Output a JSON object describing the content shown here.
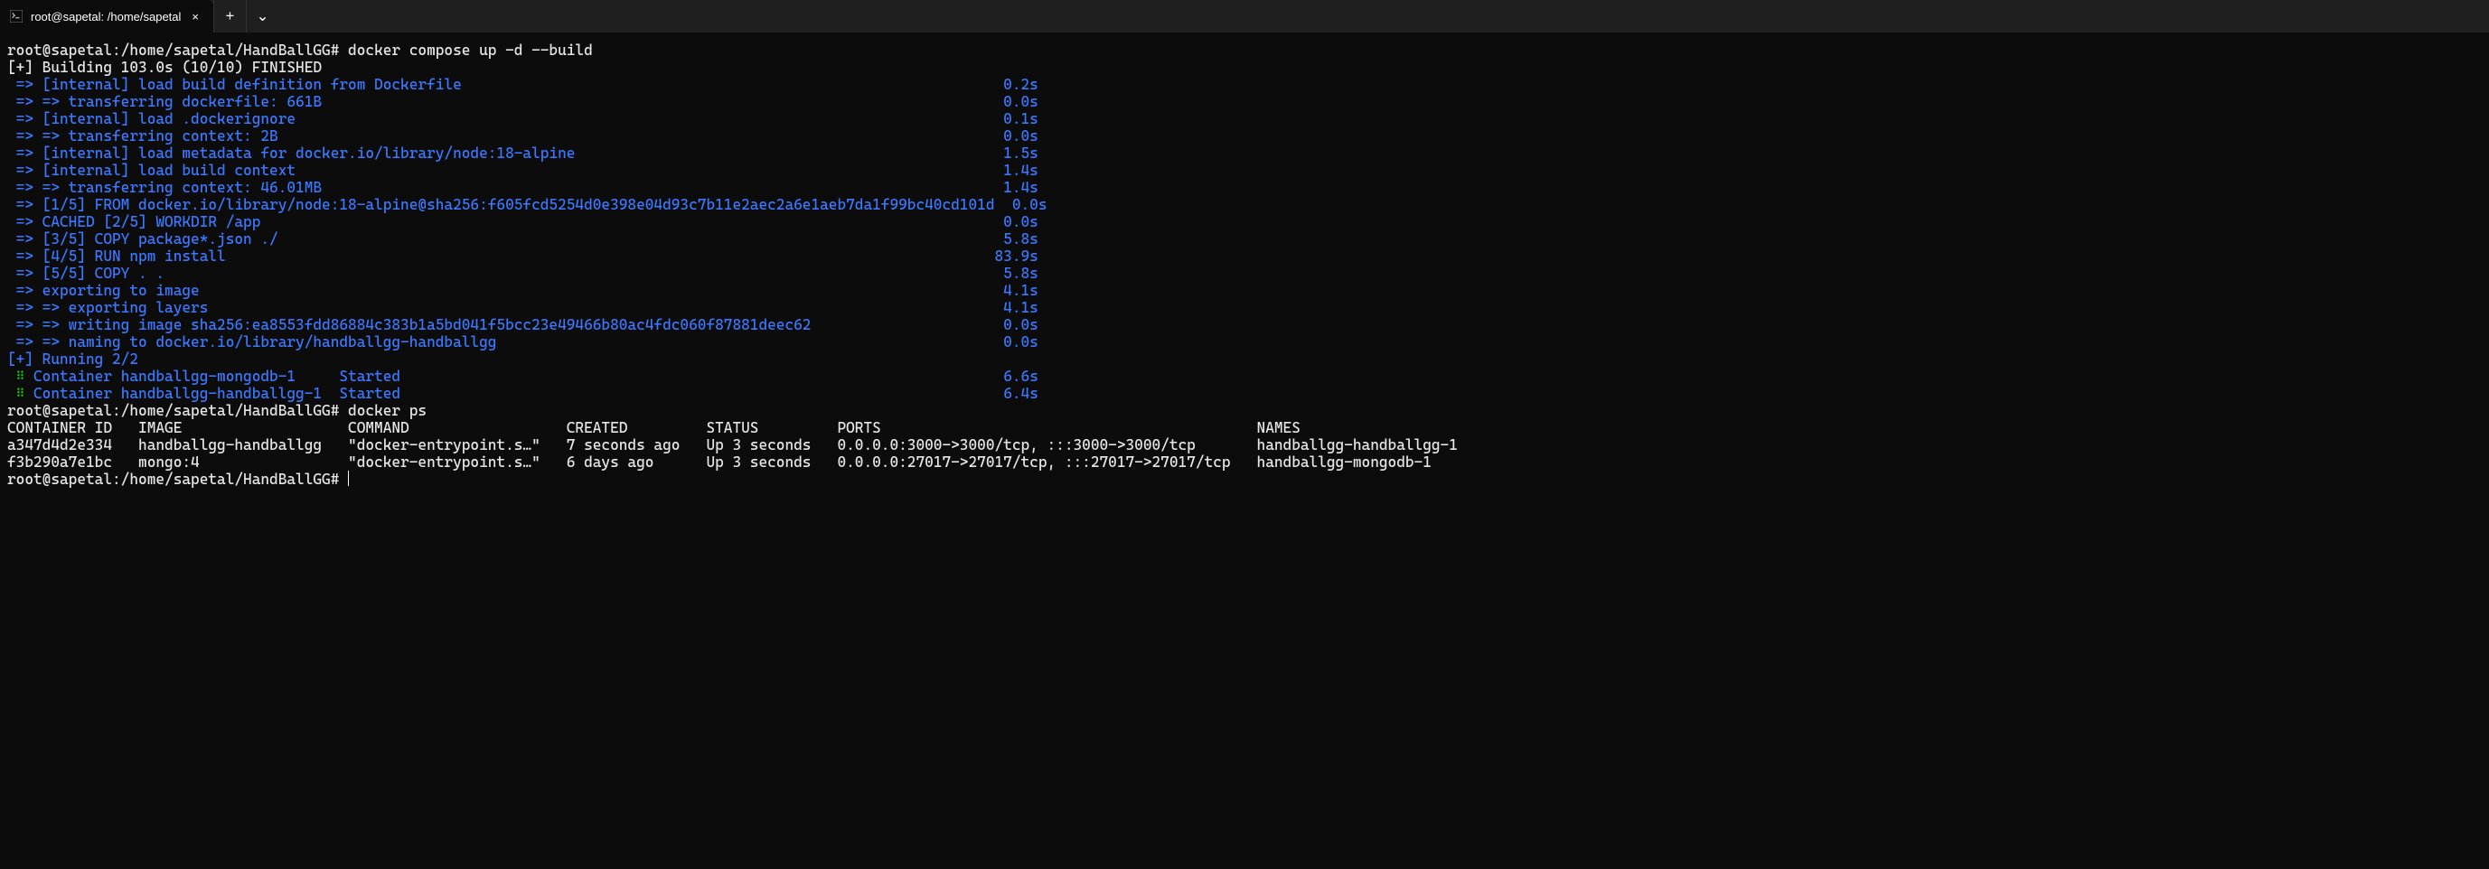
{
  "titlebar": {
    "tab_title": "root@sapetal: /home/sapetal",
    "tab_close": "×",
    "newtab": "+",
    "dropdown": "⌄"
  },
  "prompt1": {
    "user": "root@sapetal",
    "path": ":/home/sapetal/HandBallGG#",
    "cmd": " docker compose up -d --build"
  },
  "build_header": "[+] Building 103.0s (10/10) FINISHED",
  "steps": [
    {
      "txt": " => [internal] load build definition from Dockerfile",
      "time": "0.2s"
    },
    {
      "txt": " => => transferring dockerfile: 661B",
      "time": "0.0s"
    },
    {
      "txt": " => [internal] load .dockerignore",
      "time": "0.1s"
    },
    {
      "txt": " => => transferring context: 2B",
      "time": "0.0s"
    },
    {
      "txt": " => [internal] load metadata for docker.io/library/node:18-alpine",
      "time": "1.5s"
    },
    {
      "txt": " => [internal] load build context",
      "time": "1.4s"
    },
    {
      "txt": " => => transferring context: 46.01MB",
      "time": "1.4s"
    },
    {
      "txt": " => [1/5] FROM docker.io/library/node:18-alpine@sha256:f605fcd5254d0e398e04d93c7b11e2aec2a6e1aeb7da1f99bc40cd101d",
      "time": "0.0s"
    },
    {
      "txt": " => CACHED [2/5] WORKDIR /app",
      "time": "0.0s"
    },
    {
      "txt": " => [3/5] COPY package*.json ./",
      "time": "5.8s"
    },
    {
      "txt": " => [4/5] RUN npm install",
      "time": "83.9s"
    },
    {
      "txt": " => [5/5] COPY . .",
      "time": "5.8s"
    },
    {
      "txt": " => exporting to image",
      "time": "4.1s"
    },
    {
      "txt": " => => exporting layers",
      "time": "4.1s"
    },
    {
      "txt": " => => writing image sha256:ea8553fdd86884c383b1a5bd041f5bcc23e49466b80ac4fdc060f87881deec62",
      "time": "0.0s"
    },
    {
      "txt": " => => naming to docker.io/library/handballgg-handballgg",
      "time": "0.0s"
    }
  ],
  "running_header": "[+] Running 2/2",
  "containers_start": [
    {
      "glyph": " ⠿ ",
      "name": "Container handballgg-mongodb-1    ",
      "status": "Started",
      "time": "6.6s"
    },
    {
      "glyph": " ⠿ ",
      "name": "Container handballgg-handballgg-1 ",
      "status": "Started",
      "time": "6.4s"
    }
  ],
  "prompt2": {
    "user": "root@sapetal",
    "path": ":/home/sapetal/HandBallGG#",
    "cmd": " docker ps"
  },
  "ps_header": "CONTAINER ID   IMAGE                   COMMAND                  CREATED         STATUS         PORTS                                           NAMES",
  "ps_rows": [
    "a347d4d2e334   handballgg-handballgg   \"docker-entrypoint.s…\"   7 seconds ago   Up 3 seconds   0.0.0.0:3000->3000/tcp, :::3000->3000/tcp       handballgg-handballgg-1",
    "f3b290a7e1bc   mongo:4                 \"docker-entrypoint.s…\"   6 days ago      Up 3 seconds   0.0.0.0:27017->27017/tcp, :::27017->27017/tcp   handballgg-mongodb-1"
  ],
  "prompt3": {
    "user": "root@sapetal",
    "path": ":/home/sapetal/HandBallGG#",
    "cmd": " "
  }
}
